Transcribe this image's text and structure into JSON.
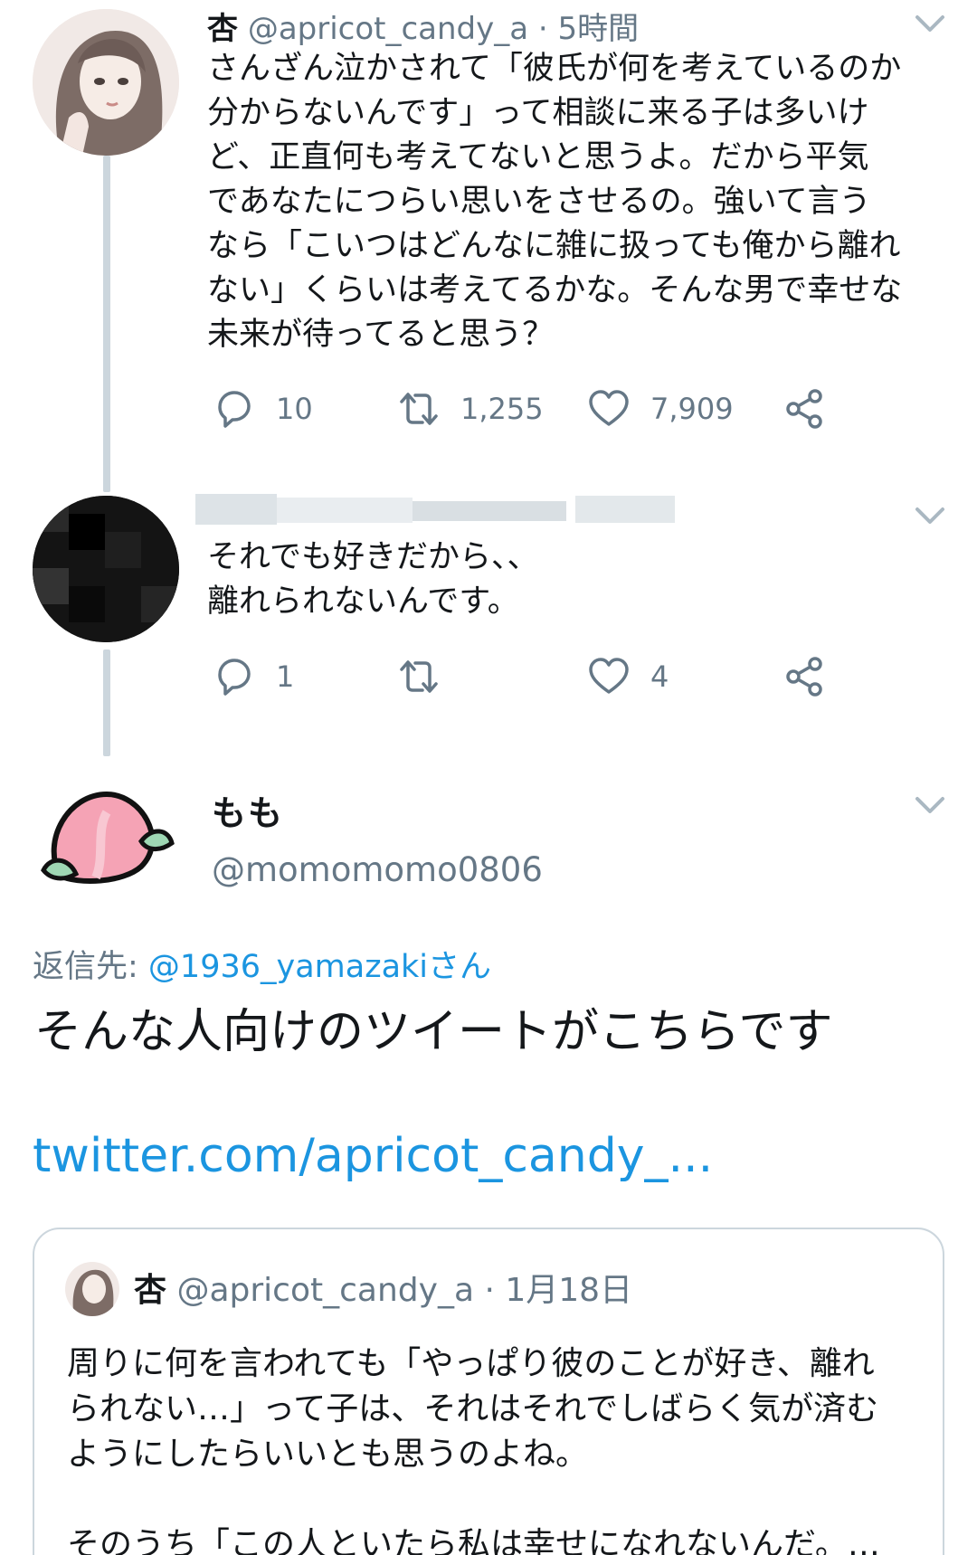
{
  "colors": {
    "link": "#1b95e0",
    "secondary_text": "#657786",
    "thread_line": "#ccd6dd",
    "border": "#ccd6dd"
  },
  "tweet1": {
    "display_name": "杏",
    "handle": "@apricot_candy_a",
    "time": "· 5時間",
    "text": "さんざん泣かされて「彼氏が何を考えているのか\n分からないんです」って相談に来る子は多いけ\nど、正直何も考えてないと思うよ。だから平気\nであなたにつらい思いをさせるの。強いて言う\nなら「こいつはどんなに雑に扱っても俺から離れ\nない」くらいは考えてるかな。そんな男で幸せな\n未来が待ってると思う？",
    "replies": "10",
    "retweets": "1,255",
    "likes": "7,909",
    "icons": [
      "reply-icon",
      "retweet-icon",
      "like-icon",
      "share-icon"
    ]
  },
  "tweet2": {
    "text": "それでも好きだから、、\n離れられないんです。",
    "replies": "1",
    "likes": "4"
  },
  "tweet3": {
    "display_name": "もも",
    "handle": "@momomomo0806",
    "reply_prefix": "返信先: ",
    "reply_to": "@1936_yamazakiさん",
    "text": "そんな人向けのツイートがこちらです",
    "link": "twitter.com/apricot_candy_..."
  },
  "quote": {
    "display_name": "杏",
    "handle": "@apricot_candy_a",
    "time": "· 1月18日",
    "text": "周りに何を言われても「やっぱり彼のことが好き、離れ\nられない…」って子は、それはそれでしばらく気が済む\nようにしたらいいとも思うのよね。\n\nそのうち「この人といたら私は幸せになれないんだ。…"
  }
}
